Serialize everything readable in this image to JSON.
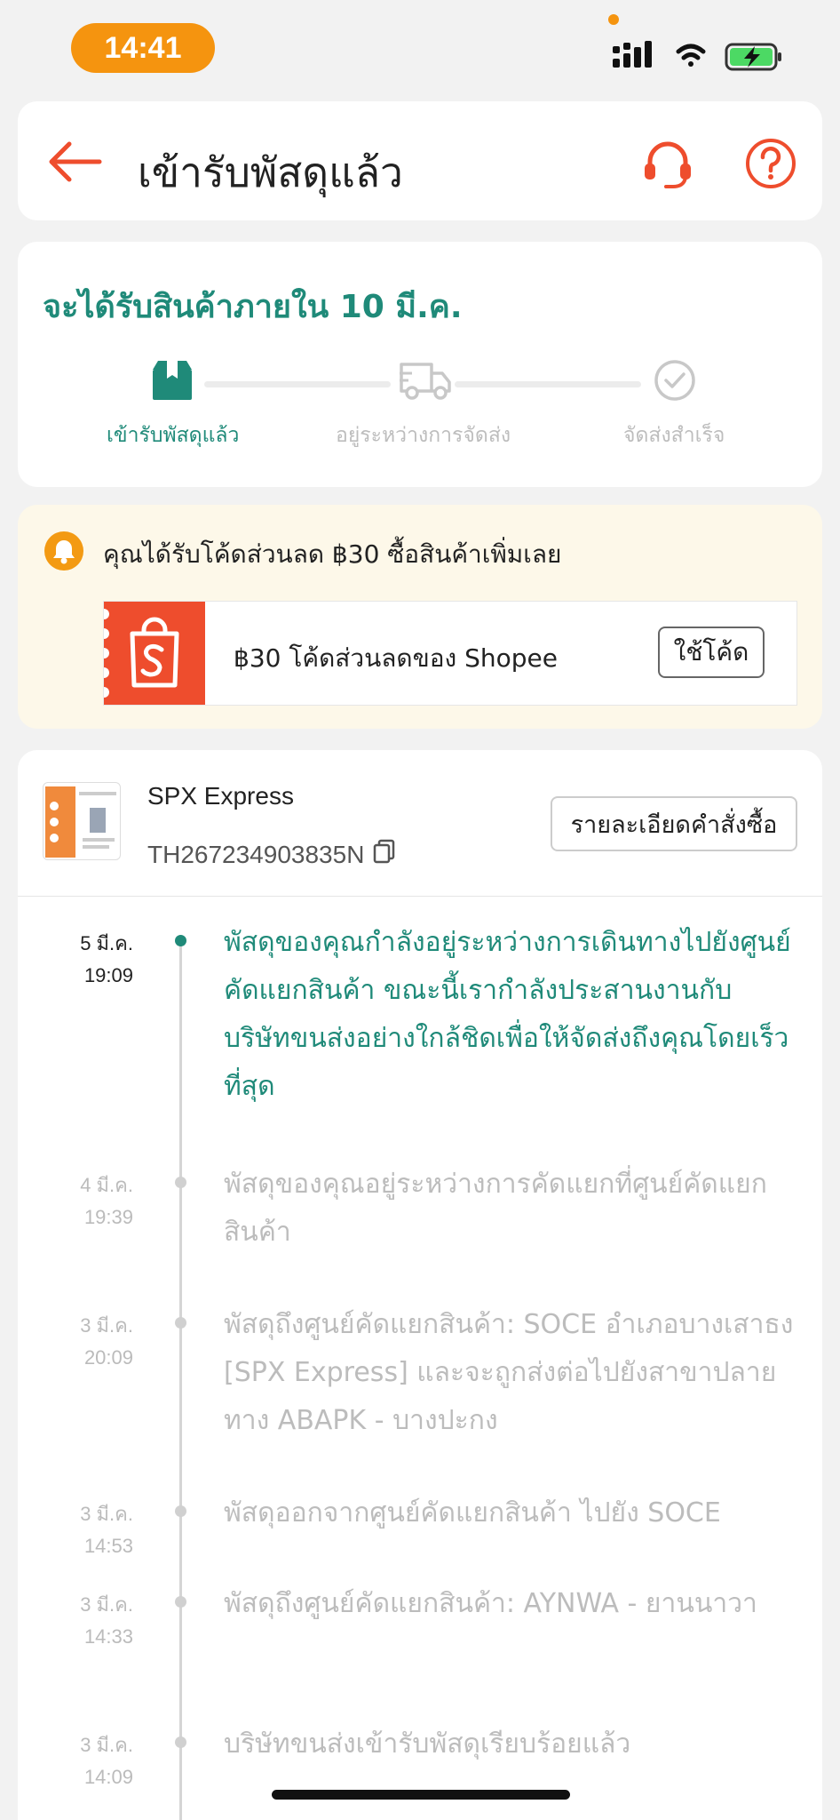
{
  "status_bar": {
    "time": "14:41"
  },
  "header": {
    "title": "เข้ารับพัสดุแล้ว"
  },
  "progress": {
    "eta": "จะได้รับสินค้าภายใน 10 มี.ค.",
    "steps": [
      {
        "label": "เข้ารับพัสดุแล้ว",
        "icon": "box-icon",
        "state": "active"
      },
      {
        "label": "อยู่ระหว่างการจัดส่ง",
        "icon": "truck-icon",
        "state": "pending"
      },
      {
        "label": "จัดส่งสำเร็จ",
        "icon": "check-circle-icon",
        "state": "pending"
      }
    ]
  },
  "voucher": {
    "note": "คุณได้รับโค้ดส่วนลด ฿30 ซื้อสินค้าเพิ่มเลย",
    "ticket_text": "฿30 โค้ดส่วนลดของ Shopee",
    "button_label": "ใช้โค้ด"
  },
  "shipment": {
    "courier": "SPX Express",
    "tracking_number": "TH267234903835N",
    "detail_button": "รายละเอียดคำสั่งซื้อ"
  },
  "events": [
    {
      "date": "5 มี.ค.",
      "time": "19:09",
      "text": "พัสดุของคุณกำลังอยู่ระหว่างการเดินทางไปยังศูนย์คัดแยกสินค้า ขณะนี้เรากำลังประสานงานกับบริษัทขนส่งอย่างใกล้ชิดเพื่อให้จัดส่งถึงคุณโดยเร็วที่สุด",
      "active": true
    },
    {
      "date": "4 มี.ค.",
      "time": "19:39",
      "text": "พัสดุของคุณอยู่ระหว่างการคัดแยกที่ศูนย์คัดแยกสินค้า",
      "active": false
    },
    {
      "date": "3 มี.ค.",
      "time": "20:09",
      "text": "พัสดุถึงศูนย์คัดแยกสินค้า: SOCE อำเภอบางเสาธง [SPX Express] และจะถูกส่งต่อไปยังสาขาปลายทาง ABAPK - บางปะกง",
      "active": false
    },
    {
      "date": "3 มี.ค.",
      "time": "14:53",
      "text": "พัสดุออกจากศูนย์คัดแยกสินค้า ไปยัง SOCE",
      "active": false
    },
    {
      "date": "3 มี.ค.",
      "time": "14:33",
      "text": "พัสดุถึงศูนย์คัดแยกสินค้า: AYNWA - ยานนาวา",
      "active": false
    },
    {
      "date": "3 มี.ค.",
      "time": "14:09",
      "text": "บริษัทขนส่งเข้ารับพัสดุเรียบร้อยแล้ว",
      "active": false
    }
  ],
  "colors": {
    "accent": "#ee4d2d",
    "teal": "#1f8a79",
    "orange": "#f5940f"
  }
}
